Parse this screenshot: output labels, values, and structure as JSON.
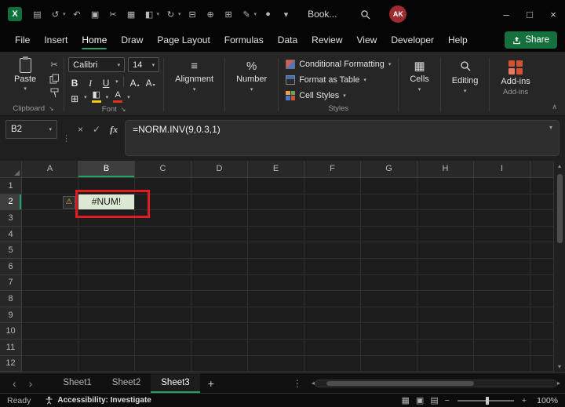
{
  "titlebar": {
    "logo_letter": "X",
    "title": "Book...",
    "avatar_initials": "AK",
    "icons": [
      {
        "name": "save",
        "glyph": "▤"
      },
      {
        "name": "undo",
        "glyph": "↺",
        "chevron": true
      },
      {
        "name": "redo",
        "glyph": "↶"
      },
      {
        "name": "clipboard",
        "glyph": "▣"
      },
      {
        "name": "cut",
        "glyph": "✂"
      },
      {
        "name": "chart",
        "glyph": "▦"
      },
      {
        "name": "format-painter",
        "glyph": "◧",
        "chevron": true
      },
      {
        "name": "undo-history",
        "glyph": "↻",
        "chevron": true
      },
      {
        "name": "print",
        "glyph": "⊟"
      },
      {
        "name": "quick-add",
        "glyph": "⊕"
      },
      {
        "name": "table",
        "glyph": "⊞"
      },
      {
        "name": "draw",
        "glyph": "✎",
        "chevron": true
      },
      {
        "name": "record",
        "glyph": "●"
      },
      {
        "name": "qat-overflow",
        "glyph": "▾"
      }
    ]
  },
  "menu": {
    "items": [
      "File",
      "Insert",
      "Home",
      "Draw",
      "Page Layout",
      "Formulas",
      "Data",
      "Review",
      "View",
      "Developer",
      "Help"
    ],
    "active": "Home",
    "share": "Share"
  },
  "ribbon": {
    "paste_label": "Paste",
    "clipboard_group": "Clipboard",
    "font_name": "Calibri",
    "font_size": "14",
    "bold": "B",
    "italic": "I",
    "underline": "U",
    "grow_font": "A",
    "shrink_font": "A",
    "font_color_letter": "A",
    "font_group": "Font",
    "alignment_label": "Alignment",
    "number_label": "Number",
    "styles": {
      "conditional": "Conditional Formatting",
      "format_table": "Format as Table",
      "cell_styles": "Cell Styles",
      "group": "Styles"
    },
    "cells_label": "Cells",
    "editing_label": "Editing",
    "addins_label": "Add-ins",
    "addins_group": "Add-ins"
  },
  "formula_bar": {
    "name_box": "B2",
    "fx": "fx",
    "formula": "=NORM.INV(9,0.3,1)"
  },
  "grid": {
    "columns": [
      "A",
      "B",
      "C",
      "D",
      "E",
      "F",
      "G",
      "H",
      "I"
    ],
    "rows": [
      "1",
      "2",
      "3",
      "4",
      "5",
      "6",
      "7",
      "8",
      "9",
      "10",
      "11",
      "12"
    ],
    "selected_column": "B",
    "selected_row": "2",
    "active_cell": "B2",
    "active_cell_value": "#NUM!",
    "error_badge_cell": "A2"
  },
  "tabs": {
    "sheets": [
      "Sheet1",
      "Sheet2",
      "Sheet3"
    ],
    "active": "Sheet3"
  },
  "status": {
    "ready": "Ready",
    "accessibility": "Accessibility: Investigate",
    "zoom": "100%"
  },
  "icons": {
    "chevron_down": "▾",
    "chevron_up": "∧",
    "dots_vertical": "⋮",
    "minimize": "–",
    "maximize": "□",
    "close": "×",
    "scroll_up": "▴",
    "scroll_down": "▾",
    "scroll_left": "◂",
    "scroll_right": "▸",
    "tab_nav_left": "‹",
    "tab_nav_right": "›",
    "add": "+",
    "launcher": "↘",
    "cancel": "×",
    "enter": "✓",
    "scissors": "✂",
    "borders": "⊞",
    "fill_bucket": "◧",
    "caret_up": "▴",
    "caret_down": "▾",
    "align_lines": "≡",
    "percent": "%",
    "cells_grid": "▦",
    "view_normal": "▦",
    "view_layout": "▣",
    "view_break": "▤",
    "minus": "−",
    "plus": "+",
    "warning": "⚠"
  },
  "colors": {
    "excel_green": "#107c41",
    "accent_green": "#21a366",
    "annotation_red": "#e01b24",
    "cell_fill_green": "#dbe8d3",
    "warning_orange": "#e8a33d",
    "avatar_red": "#9e2b2f"
  }
}
